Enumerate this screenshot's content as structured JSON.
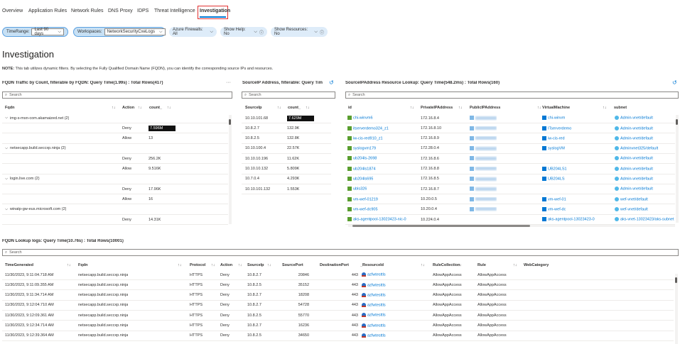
{
  "tabs": [
    "Overview",
    "Application Rules",
    "Network Rules",
    "DNS Proxy",
    "IDPS",
    "Threat Intelligence",
    "Investigation"
  ],
  "filters": {
    "timerange_label": "TimeRange:",
    "timerange_value": "Last 90 days",
    "workspaces_label": "Workspaces:",
    "workspaces_value": "NetworkSecurityCxeLogs",
    "firewalls": "Azure Firewalls: All",
    "show_help": "Show Help: No",
    "show_resources": "Show Resources: No"
  },
  "page_title": "Investigation",
  "note_label": "NOTE:",
  "note_text": " This tab utilizes dynamic filters. By selecting the Fully Qualified Domain Name (FQDN), you can identify the corresponding source IPs and resources.",
  "search_placeholder": "Search",
  "fqdn_panel": {
    "title": "FQDN Traffic by Count, filterable by FQDN: Query Time(1.99s) : Total Rows(417)",
    "columns": [
      "Fqdn",
      "Action",
      "count_"
    ],
    "rows": [
      {
        "g": "img-s-msn-com.akamaized.net (2)"
      },
      {
        "a": "Deny",
        "v": "7.596M",
        "bar": true
      },
      {
        "a": "Allow",
        "v": "13"
      },
      {
        "g": "netsecapp.build.seccxp.ninja (2)"
      },
      {
        "a": "Deny",
        "v": "256.2K"
      },
      {
        "a": "Allow",
        "v": "9.516K"
      },
      {
        "g": "login.live.com (2)"
      },
      {
        "a": "Deny",
        "v": "17.96K"
      },
      {
        "a": "Allow",
        "v": "16"
      },
      {
        "g": "winatp-gw-eus.microsoft.com (2)"
      },
      {
        "a": "Deny",
        "v": "14.31K"
      }
    ]
  },
  "srcip_panel": {
    "title": "SourceIP Address, filterable: Query Time",
    "columns": [
      "SourceIp",
      "count_"
    ],
    "rows": [
      [
        "10.10.101.68",
        "7.629M"
      ],
      [
        "10.8.2.7",
        "132.9K"
      ],
      [
        "10.8.2.5",
        "132.8K"
      ],
      [
        "10.10.100.4",
        "22.57K"
      ],
      [
        "10.10.10.196",
        "11.62K"
      ],
      [
        "10.10.10.132",
        "5.809K"
      ],
      [
        "10.7.0.4",
        "4.293K"
      ],
      [
        "10.10.101.132",
        "1.553K"
      ]
    ]
  },
  "resource_panel": {
    "title": "SourceIPAddress Resource Lookup: Query Time(548.2ms) : Total Rows(160)",
    "columns": [
      "id",
      "PrivateIPAddress",
      "PublicIPAddress",
      "VirtualMachine",
      "subnet"
    ],
    "rows": [
      [
        "chi-winvm6",
        "172.16.8.4",
        "chi-winvm",
        "Admin-vnet/default"
      ],
      [
        "itserverdemo324_z1",
        "172.16.8.10",
        "ITserverdemo",
        "Admin-vnet/default"
      ],
      [
        "iw-cis-red910_z1",
        "172.16.8.9",
        "iw-cis-red",
        "Admin-vnet/default"
      ],
      [
        "syslogvm179",
        "172.28.0.4",
        "syslogVM",
        "Adminvnet325/default"
      ],
      [
        "ub204ls-2698",
        "172.16.8.6",
        "",
        "Admin-vnet/default"
      ],
      [
        "ub204ls1874",
        "172.16.8.8",
        "UB204LS1",
        "Admin-vnet/default"
      ],
      [
        "ub204ls695",
        "172.16.8.5",
        "UB204LS",
        "Admin-vnet/default"
      ],
      [
        "ubls326",
        "172.16.8.7",
        "",
        "Admin-vnet/default"
      ],
      [
        "vm-wef-01219",
        "10.20.0.5",
        "vm-wef-01",
        "wef-vnet/default"
      ],
      [
        "vm-wef-dc905",
        "10.20.0.4",
        "vm-wef-dc",
        "wef-vnet/default"
      ],
      [
        "aks-agentpool-13023423-nic-0",
        "10.224.0.4",
        "aks-agentpool-13023423-0",
        "aks-vnet-13023423/aks-subnet"
      ]
    ]
  },
  "logs_panel": {
    "title": "FQDN Lookup logs: Query Time(10.76s) : Total Rows(10001)",
    "columns": [
      "TimeGenerated",
      "Fqdn",
      "Protocol",
      "Action",
      "SourceIp",
      "SourcePort",
      "DestinationPort",
      "_ResourceId",
      "RuleCollection",
      "Rule",
      "WebCategory"
    ],
    "rows": [
      [
        "11/30/2023, 9:11:04.718 AM",
        "netsecapp.build.seccxp.ninja",
        "HTTPS",
        "Deny",
        "10.8.2.7",
        "20846",
        "443",
        "azfwtesttls",
        "AllowAppAccess",
        "AllowAppAccess"
      ],
      [
        "11/30/2023, 9:11:09.355 AM",
        "netsecapp.build.seccxp.ninja",
        "HTTPS",
        "Deny",
        "10.8.2.5",
        "35152",
        "443",
        "azfwtesttls",
        "AllowAppAccess",
        "AllowAppAccess"
      ],
      [
        "11/30/2023, 9:11:34.714 AM",
        "netsecapp.build.seccxp.ninja",
        "HTTPS",
        "Deny",
        "10.8.2.7",
        "18208",
        "443",
        "azfwtesttls",
        "AllowAppAccess",
        "AllowAppAccess"
      ],
      [
        "11/30/2023, 9:12:04.710 AM",
        "netsecapp.build.seccxp.ninja",
        "HTTPS",
        "Deny",
        "10.8.2.7",
        "54728",
        "443",
        "azfwtesttls",
        "AllowAppAccess",
        "AllowAppAccess"
      ],
      [
        "11/30/2023, 9:12:09.361 AM",
        "netsecapp.build.seccxp.ninja",
        "HTTPS",
        "Deny",
        "10.8.2.5",
        "55770",
        "443",
        "azfwtesttls",
        "AllowAppAccess",
        "AllowAppAccess"
      ],
      [
        "11/30/2023, 9:12:34.714 AM",
        "netsecapp.build.seccxp.ninja",
        "HTTPS",
        "Deny",
        "10.8.2.7",
        "16236",
        "443",
        "azfwtesttls",
        "AllowAppAccess",
        "AllowAppAccess"
      ],
      [
        "11/30/2023, 9:12:39.364 AM",
        "netsecapp.build.seccxp.ninja",
        "HTTPS",
        "Deny",
        "10.8.2.5",
        "34650",
        "443",
        "azfwtesttls",
        "AllowAppAccess",
        "AllowAppAccess"
      ]
    ]
  }
}
